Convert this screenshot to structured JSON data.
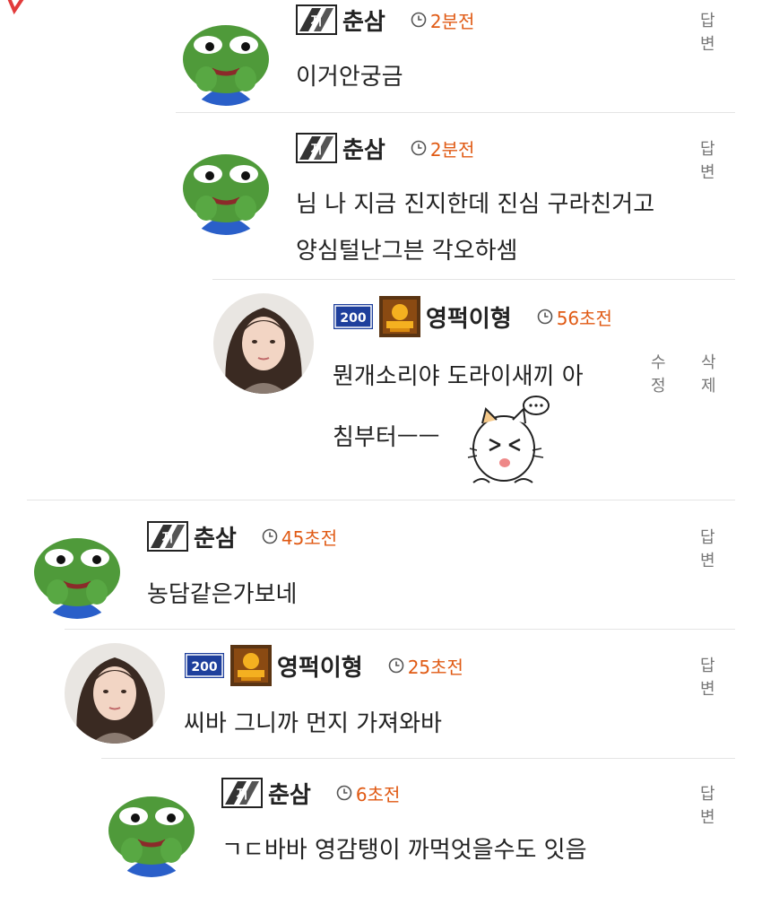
{
  "comments": [
    {
      "author": "춘삼",
      "time": "2분전",
      "reply": "답변",
      "text": [
        "이거안궁금"
      ]
    },
    {
      "author": "춘삼",
      "time": "2분전",
      "reply": "답변",
      "text": [
        "님 나 지금 진지한데 진심 구라친거고",
        "양심털난그븐 각오하셈"
      ]
    },
    {
      "author": "영퍽이형",
      "level": "200",
      "time": "56초전",
      "edit": "수정",
      "delete": "삭제",
      "text": [
        "뭔개소리야 도라이새끼 아",
        "침부터ㅡㅡ"
      ]
    },
    {
      "author": "춘삼",
      "time": "45초전",
      "reply": "답변",
      "text": [
        "농담같은가보네"
      ]
    },
    {
      "author": "영퍽이형",
      "level": "200",
      "time": "25초전",
      "reply": "답변",
      "text": [
        "씨바 그니까 먼지 가져와바"
      ]
    },
    {
      "author": "춘삼",
      "time": "6초전",
      "reply": "답변",
      "text": [
        "ㄱㄷ바바 영감탱이 까먹엇을수도 잇음"
      ]
    }
  ],
  "icons": {
    "frog_avatar": "pepe-frog-avatar",
    "girl_avatar": "user-photo-avatar",
    "clock": "clock-icon",
    "sticker": "cat-emoticon-sticker"
  },
  "colors": {
    "time": "#e05a14",
    "frog": "#4f9a3a",
    "divider": "#e4e4e4",
    "level_badge": "#1e3f9c"
  }
}
